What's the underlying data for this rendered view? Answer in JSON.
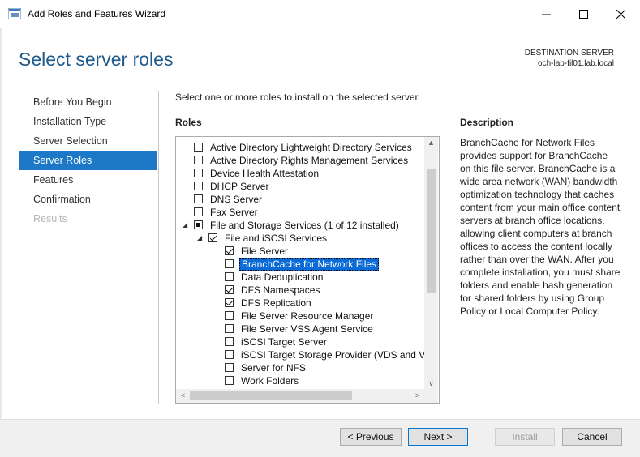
{
  "window": {
    "title": "Add Roles and Features Wizard",
    "minimize_glyph": "—",
    "maximize_glyph": "☐",
    "close_glyph": "✕"
  },
  "page": {
    "heading": "Select server roles",
    "destination_label": "DESTINATION SERVER",
    "destination_server": "och-lab-fil01.lab.local",
    "instruction": "Select one or more roles to install on the selected server."
  },
  "nav": {
    "items": [
      {
        "label": "Before You Begin",
        "state": "normal"
      },
      {
        "label": "Installation Type",
        "state": "normal"
      },
      {
        "label": "Server Selection",
        "state": "normal"
      },
      {
        "label": "Server Roles",
        "state": "active"
      },
      {
        "label": "Features",
        "state": "normal"
      },
      {
        "label": "Confirmation",
        "state": "normal"
      },
      {
        "label": "Results",
        "state": "disabled"
      }
    ]
  },
  "roles": {
    "header": "Roles",
    "items": [
      {
        "label": "Active Directory Lightweight Directory Services",
        "check": "none",
        "level": 0,
        "expander": ""
      },
      {
        "label": "Active Directory Rights Management Services",
        "check": "none",
        "level": 0,
        "expander": ""
      },
      {
        "label": "Device Health Attestation",
        "check": "none",
        "level": 0,
        "expander": ""
      },
      {
        "label": "DHCP Server",
        "check": "none",
        "level": 0,
        "expander": ""
      },
      {
        "label": "DNS Server",
        "check": "none",
        "level": 0,
        "expander": ""
      },
      {
        "label": "Fax Server",
        "check": "none",
        "level": 0,
        "expander": ""
      },
      {
        "label": "File and Storage Services (1 of 12 installed)",
        "check": "partial",
        "level": 0,
        "expander": "◢"
      },
      {
        "label": "File and iSCSI Services",
        "check": "checked",
        "level": 1,
        "expander": "◢"
      },
      {
        "label": "File Server",
        "check": "checked",
        "level": 2,
        "expander": ""
      },
      {
        "label": "BranchCache for Network Files",
        "check": "none",
        "level": 2,
        "expander": "",
        "selected": true
      },
      {
        "label": "Data Deduplication",
        "check": "none",
        "level": 2,
        "expander": ""
      },
      {
        "label": "DFS Namespaces",
        "check": "checked",
        "level": 2,
        "expander": ""
      },
      {
        "label": "DFS Replication",
        "check": "checked",
        "level": 2,
        "expander": ""
      },
      {
        "label": "File Server Resource Manager",
        "check": "none",
        "level": 2,
        "expander": ""
      },
      {
        "label": "File Server VSS Agent Service",
        "check": "none",
        "level": 2,
        "expander": ""
      },
      {
        "label": "iSCSI Target Server",
        "check": "none",
        "level": 2,
        "expander": ""
      },
      {
        "label": "iSCSI Target Storage Provider (VDS and VSS",
        "check": "none",
        "level": 2,
        "expander": ""
      },
      {
        "label": "Server for NFS",
        "check": "none",
        "level": 2,
        "expander": ""
      },
      {
        "label": "Work Folders",
        "check": "none",
        "level": 2,
        "expander": ""
      }
    ],
    "scroll_up_glyph": "▲",
    "scroll_down_glyph": "∨",
    "scroll_left_glyph": "<",
    "scroll_right_glyph": ">"
  },
  "description": {
    "header": "Description",
    "text": "BranchCache for Network Files provides support for BranchCache on this file server. BranchCache is a wide area network (WAN) bandwidth optimization technology that caches content from your main office content servers at branch office locations, allowing client computers at branch offices to access the content locally rather than over the WAN. After you complete installation, you must share folders and enable hash generation for shared folders by using Group Policy or Local Computer Policy."
  },
  "buttons": {
    "previous": "< Previous",
    "next": "Next >",
    "install": "Install",
    "cancel": "Cancel"
  },
  "colors": {
    "heading": "#1e5a8c",
    "nav_active": "#1e78c8",
    "selection": "#0b6bd6"
  }
}
